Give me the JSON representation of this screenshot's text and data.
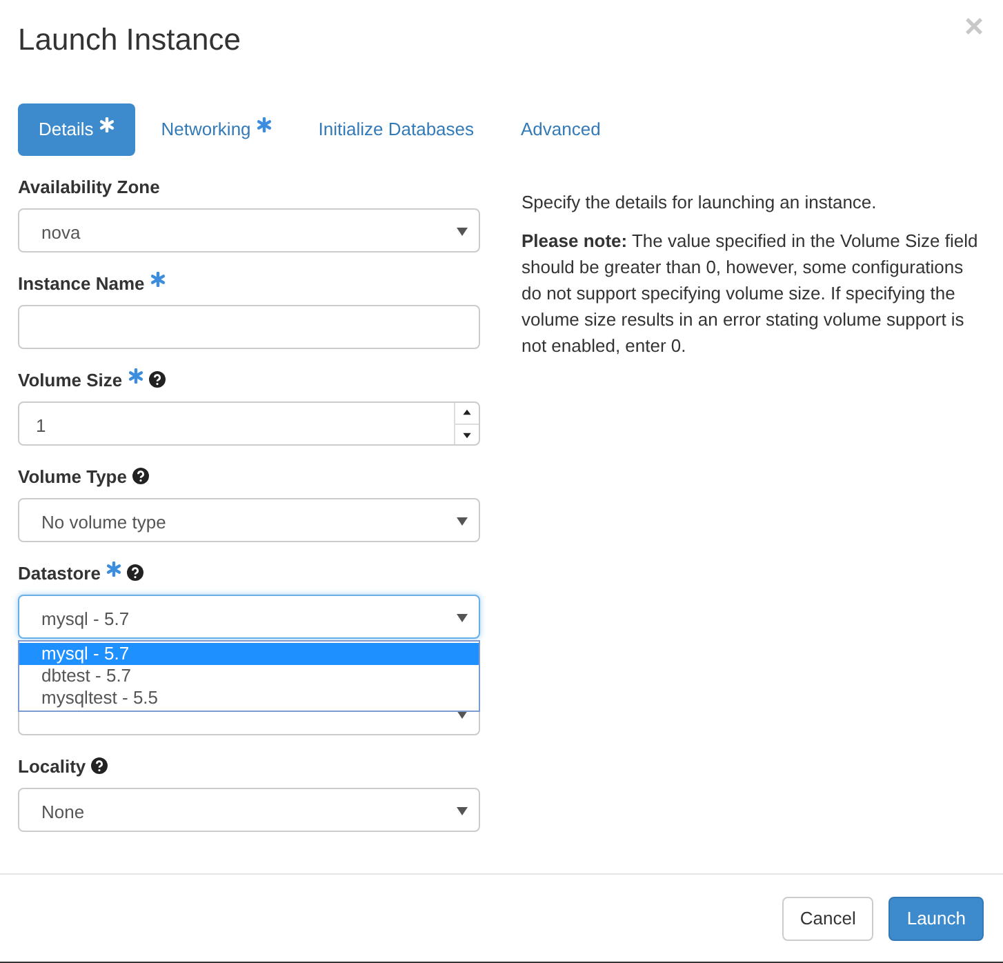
{
  "window": {
    "title": "Launch Instance",
    "close": "×"
  },
  "tabs": [
    {
      "label": "Details",
      "required": true,
      "selected": true
    },
    {
      "label": "Networking",
      "required": true,
      "selected": false
    },
    {
      "label": "Initialize Databases",
      "required": false,
      "selected": false
    },
    {
      "label": "Advanced",
      "required": false,
      "selected": false
    }
  ],
  "fields": [
    {
      "kind": "select",
      "label": "Availability Zone",
      "required": false,
      "help": false,
      "value": "nova",
      "focused": false
    },
    {
      "kind": "text",
      "label": "Instance Name",
      "required": true,
      "help": false,
      "focused": false
    },
    {
      "kind": "number",
      "label": "Volume Size",
      "required": true,
      "help": true,
      "value": "1",
      "focused": false
    },
    {
      "kind": "select",
      "label": "Volume Type",
      "required": false,
      "help": true,
      "value": "No volume type",
      "focused": false
    },
    {
      "kind": "select",
      "label": "Datastore",
      "required": true,
      "help": true,
      "value": "mysql - 5.7",
      "focused": true,
      "options": [
        {
          "label": "mysql - 5.7",
          "selected": true
        },
        {
          "label": "dbtest - 5.7",
          "selected": false
        },
        {
          "label": "mysqltest - 5.5",
          "selected": false
        }
      ]
    },
    {
      "kind": "select",
      "focused": false
    },
    {
      "kind": "select",
      "label": "Locality",
      "required": false,
      "help": true,
      "value": "None",
      "focused": false
    }
  ],
  "help_panel": {
    "intro": "Specify the details for launching an instance.",
    "note": "**Please note:** The value specified in the Volume Size field should be greater than 0, however, some configurations do not support specifying volume size. If specifying the volume size results in an error stating volume support is not enabled, enter 0."
  },
  "buttons": [
    {
      "label": "Cancel",
      "kind": "default"
    },
    {
      "label": "Launch",
      "kind": "primary"
    }
  ]
}
